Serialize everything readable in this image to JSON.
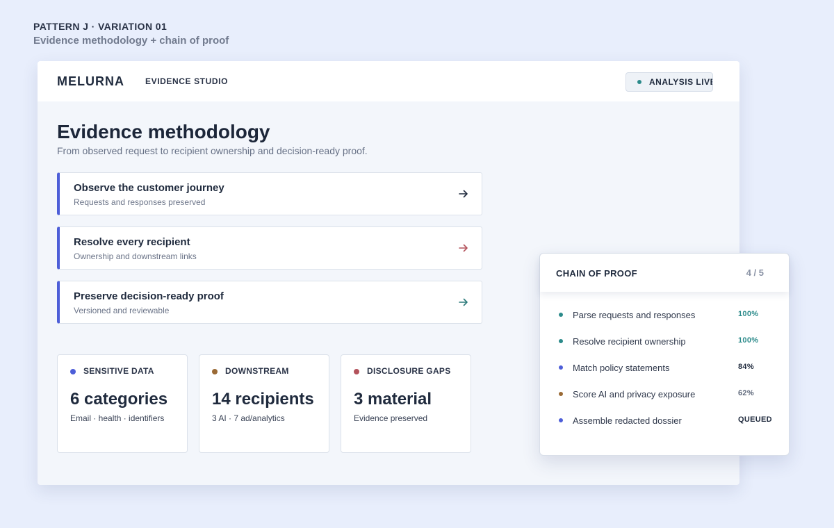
{
  "pattern": {
    "title": "PATTERN J · VARIATION 01",
    "subtitle": "Evidence methodology + chain of proof"
  },
  "topbar": {
    "brand": "MELURNA",
    "section": "EVIDENCE STUDIO",
    "status": "ANALYSIS LIVE",
    "status_color": "#2b8a8a"
  },
  "page": {
    "title": "Evidence methodology",
    "subtitle": "From observed request to recipient ownership and decision-ready proof."
  },
  "steps": [
    {
      "title": "Observe the customer journey",
      "desc": "Requests and responses preserved",
      "icon": "arrow-right-icon",
      "color": "#1f2a3d"
    },
    {
      "title": "Resolve every recipient",
      "desc": "Ownership and downstream links",
      "icon": "arrow-right-icon",
      "color": "#b3525b"
    },
    {
      "title": "Preserve decision-ready proof",
      "desc": "Versioned and reviewable",
      "icon": "arrow-right-icon",
      "color": "#2b7a7a"
    }
  ],
  "stats": [
    {
      "label": "SENSITIVE DATA",
      "value": "6 categories",
      "sub": "Email · health · identifiers",
      "color": "#4d5ed8"
    },
    {
      "label": "DOWNSTREAM",
      "value": "14 recipients",
      "sub": "3 AI · 7 ad/analytics",
      "color": "#9a6a35"
    },
    {
      "label": "DISCLOSURE GAPS",
      "value": "3 material",
      "sub": "Evidence preserved",
      "color": "#b3525b"
    }
  ],
  "chain": {
    "title": "CHAIN OF PROOF",
    "count": "4 / 5",
    "items": [
      {
        "label": "Parse requests and responses",
        "value": "100%",
        "dot": "#2b8a8a",
        "value_color": "#2b8a8a"
      },
      {
        "label": "Resolve recipient ownership",
        "value": "100%",
        "dot": "#2b8a8a",
        "value_color": "#2b8a8a"
      },
      {
        "label": "Match policy statements",
        "value": "84%",
        "dot": "#4d5ed8",
        "value_color": "#1f2a3d"
      },
      {
        "label": "Score AI and privacy exposure",
        "value": "62%",
        "dot": "#9a6a35",
        "value_color": "#5b6578"
      },
      {
        "label": "Assemble redacted dossier",
        "value": "QUEUED",
        "dot": "#4d5ed8",
        "value_color": "#1f2a3d"
      }
    ]
  }
}
